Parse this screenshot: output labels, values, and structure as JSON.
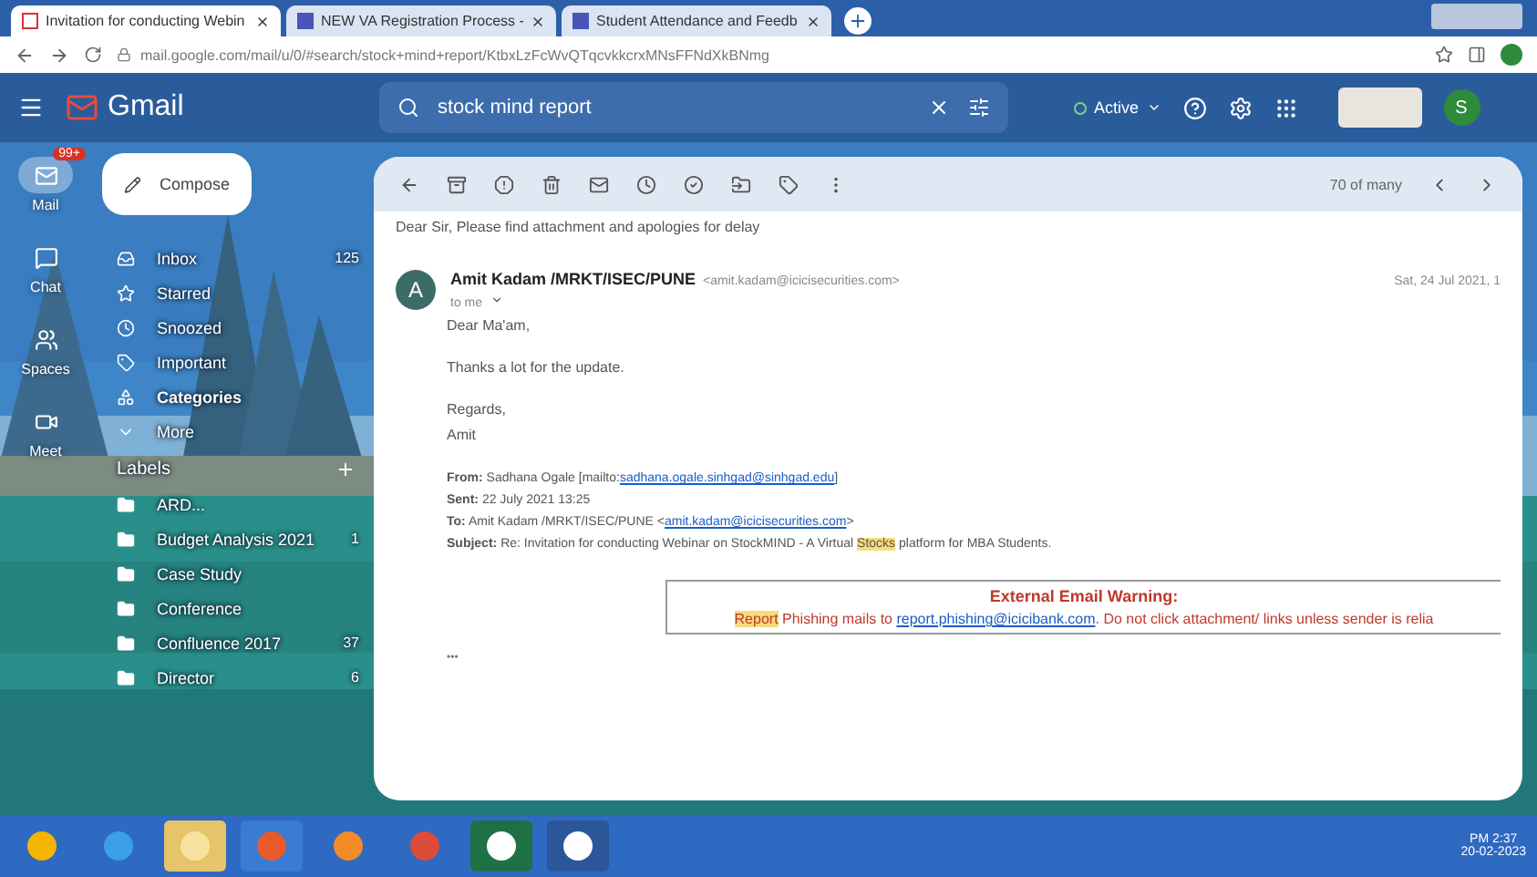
{
  "browser": {
    "tabs": [
      {
        "title": "Invitation for conducting Webin",
        "selected": true
      },
      {
        "title": "NEW VA Registration Process -",
        "selected": false
      },
      {
        "title": "Student Attendance and Feedb",
        "selected": false
      }
    ],
    "url": "mail.google.com/mail/u/0/#search/stock+mind+report/KtbxLzFcWvQTqcvkkcrxMNsFFNdXkBNmg"
  },
  "header": {
    "app": "Gmail",
    "search": "stock mind report",
    "status": "Active",
    "avatar": "S"
  },
  "rail": [
    {
      "label": "Mail",
      "badge": "99+",
      "selected": true
    },
    {
      "label": "Chat",
      "selected": false
    },
    {
      "label": "Spaces",
      "selected": false
    },
    {
      "label": "Meet",
      "selected": false
    }
  ],
  "compose": "Compose",
  "nav": [
    {
      "label": "Inbox",
      "count": "125"
    },
    {
      "label": "Starred"
    },
    {
      "label": "Snoozed"
    },
    {
      "label": "Important"
    },
    {
      "label": "Categories"
    },
    {
      "label": "More"
    }
  ],
  "labels": {
    "title": "Labels",
    "items": [
      {
        "label": "ARD..."
      },
      {
        "label": "Budget Analysis 2021",
        "count": "1"
      },
      {
        "label": "Case Study"
      },
      {
        "label": "Conference"
      },
      {
        "label": "Confluence 2017",
        "count": "37"
      },
      {
        "label": "Director",
        "count": "6"
      }
    ]
  },
  "toolbar": {
    "pager": "70 of many"
  },
  "message": {
    "snippet": "Dear Sir, Please find attachment and apologies for delay",
    "sender": "Amit Kadam /MRKT/ISEC/PUNE",
    "sender_email": "<amit.kadam@icicisecurities.com>",
    "avatar": "A",
    "date": "Sat, 24 Jul 2021, 1",
    "to": "to me",
    "body": [
      "Dear Ma'am,",
      "Thanks a lot for the update.",
      "Regards,",
      "Amit"
    ],
    "quoted": [
      {
        "label": "From:",
        "parts": [
          {
            "text": "Sadhana Ogale [mailto:"
          },
          {
            "text": "sadhana.ogale.sinhgad@sinhgad.edu",
            "kind": "link"
          },
          {
            "text": "]"
          }
        ]
      },
      {
        "label": "Sent:",
        "parts": [
          {
            "text": "22 July 2021 13:25"
          }
        ]
      },
      {
        "label": "To:",
        "parts": [
          {
            "text": "Amit Kadam /MRKT/ISEC/PUNE <"
          },
          {
            "text": "amit.kadam@icicisecurities.com",
            "kind": "link"
          },
          {
            "text": ">"
          }
        ]
      },
      {
        "label": "Subject:",
        "parts": [
          {
            "text": "Re: Invitation for conducting Webinar on StockMIND - A Virtual "
          },
          {
            "text": "Stocks",
            "kind": "highlight"
          },
          {
            "text": " platform for MBA Students."
          }
        ]
      }
    ],
    "warning": {
      "title": "External Email Warning:",
      "parts": [
        {
          "text": "Report",
          "kind": "highlight"
        },
        {
          "text": " Phishing mails to "
        },
        {
          "text": "report.phishing@icicibank.com",
          "kind": "link"
        },
        {
          "text": ". Do not click attachment/ links unless sender is relia"
        }
      ]
    },
    "ellipsis": "•••"
  },
  "taskbar": {
    "time": "PM 2:37",
    "date": "20-02-2023"
  }
}
